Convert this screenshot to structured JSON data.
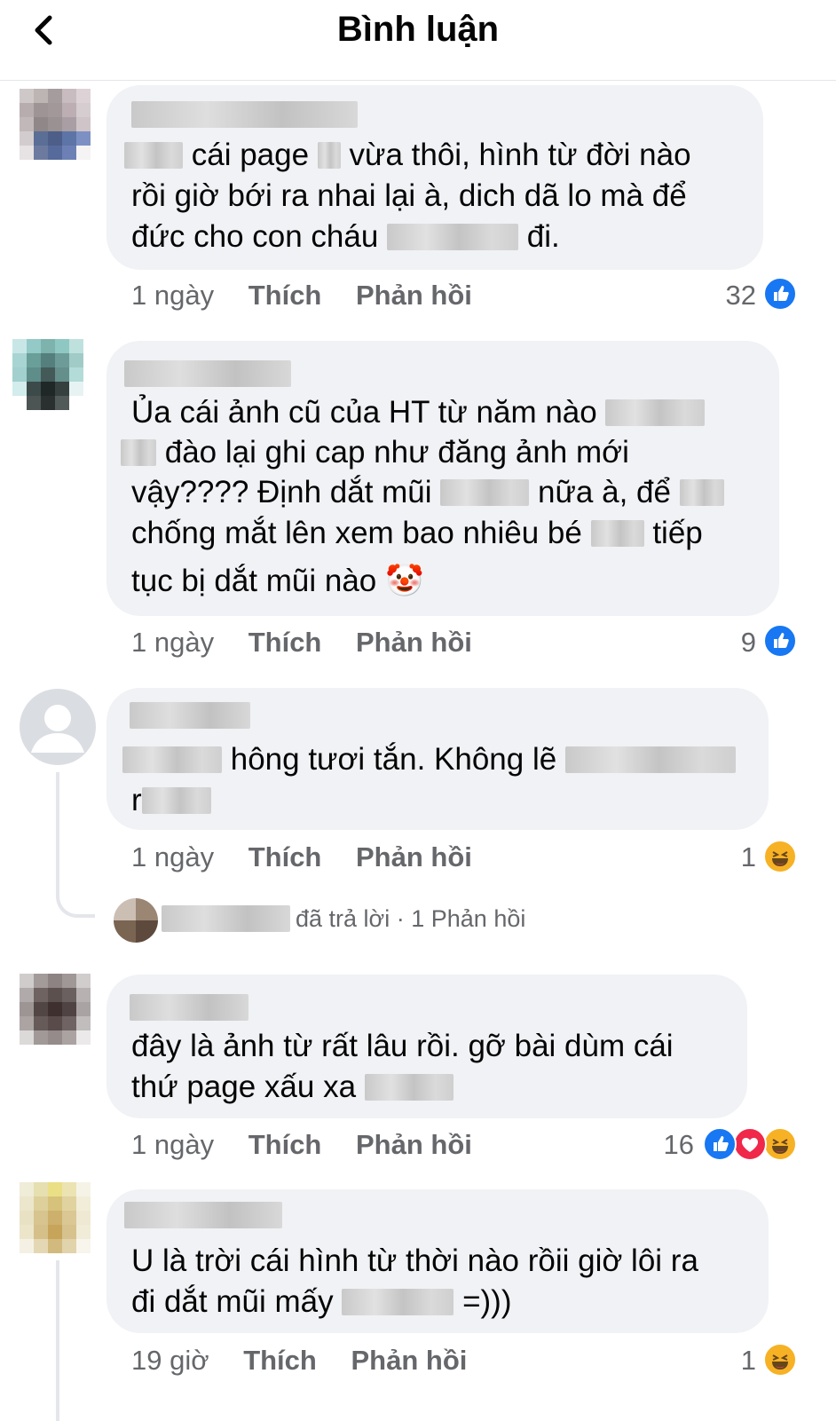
{
  "header": {
    "title": "Bình luận"
  },
  "actions": {
    "like": "Thích",
    "reply": "Phản hồi"
  },
  "comments": [
    {
      "lines": [
        "cái page",
        "vừa thôi, hình từ đời nào",
        "rồi giờ bới ra nhai lại à, dich dã lo mà để",
        "đức cho con cháu",
        "đi."
      ],
      "time": "1 ngày",
      "count": "32",
      "reactions": [
        "like-icon"
      ]
    },
    {
      "lines": [
        "Ủa cái ảnh cũ của HT từ năm nào",
        "đào lại ghi cap như đăng ảnh mới",
        "vậy???? Định dắt mũi",
        "nữa à, để",
        "chống mắt lên xem bao nhiêu bé",
        "tiếp",
        "tục bị dắt mũi nào"
      ],
      "emoji": "🤡",
      "time": "1 ngày",
      "count": "9",
      "reactions": [
        "like-icon"
      ]
    },
    {
      "lines": [
        "hông tươi tắn. Không lẽ",
        "r"
      ],
      "time": "1 ngày",
      "count": "1",
      "reactions": [
        "haha-icon"
      ],
      "reply_summary": {
        "text": "đã trả lời",
        "count_text": "1 Phản hồi"
      }
    },
    {
      "lines": [
        "đây là ảnh từ rất lâu rồi. gỡ bài dùm cái",
        "thứ page xấu xa"
      ],
      "time": "1 ngày",
      "count": "16",
      "reactions": [
        "like-icon",
        "love-icon",
        "haha-icon"
      ]
    },
    {
      "lines": [
        "U là trời cái hình từ thời nào rồii giờ lôi ra",
        "đi dắt mũi mấy",
        "=)))"
      ],
      "time": "19 giờ",
      "count": "1",
      "reactions": [
        "haha-icon"
      ]
    }
  ],
  "colors": {
    "like": "#1877f2",
    "love": "#f02849",
    "haha": "#f7b125",
    "bubble": "#f0f2f5",
    "meta": "#65676b"
  }
}
